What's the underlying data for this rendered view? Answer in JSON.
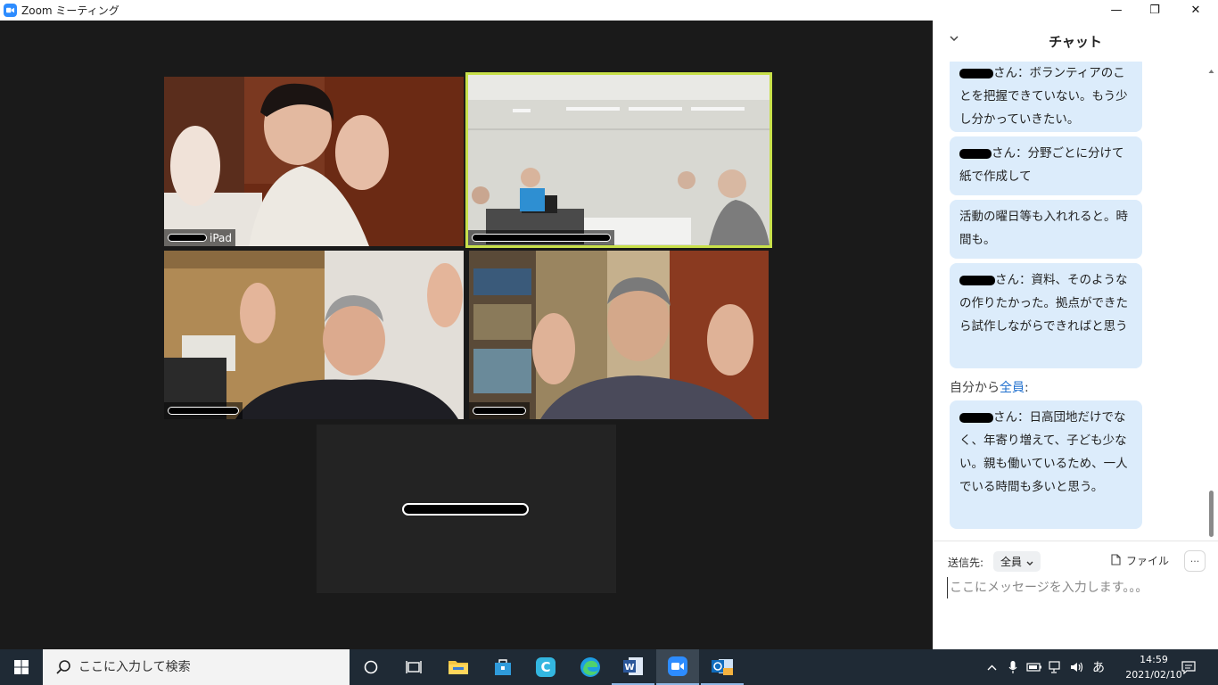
{
  "window": {
    "title": "Zoom ミーティング",
    "minimize_glyph": "—",
    "restore_glyph": "❐",
    "close_glyph": "✕"
  },
  "video": {
    "tiles": [
      {
        "name_suffix": "iPad"
      },
      {
        "name_suffix": ""
      },
      {
        "name_suffix": ""
      },
      {
        "name_suffix": ""
      },
      {
        "name_suffix": ""
      }
    ],
    "active_speaker_color": "#c8e04a"
  },
  "chat": {
    "title": "チャット",
    "messages": [
      {
        "text": "さん：ボランティアのことを把握できていない。もう少し分かっていきたい。"
      },
      {
        "text": "さん：分野ごとに分けて紙で作成して"
      },
      {
        "text": "活動の曜日等も入れれると。時間も。"
      },
      {
        "text": "さん：資料、そのようなの作りたかった。拠点ができたら試作しながらできればと思う"
      },
      {
        "text": "さん：日高団地だけでなく、年寄り増えて、子ども少ない。親も働いているため、一人でいる時間も多いと思う。"
      }
    ],
    "sender_from": "自分から",
    "sender_to": "全員",
    "sender_suffix": ":",
    "compose": {
      "recipient_label": "送信先:",
      "recipient_value": "全員",
      "file_label": "ファイル",
      "more_label": "···",
      "placeholder": "ここにメッセージを入力します。。。"
    }
  },
  "taskbar": {
    "search_placeholder": "ここに入力して検索",
    "ime_indicator": "あ",
    "time": "14:59",
    "date": "2021/02/10"
  },
  "colors": {
    "zoom_blue": "#2d8cff",
    "chat_bubble": "#dcecfb",
    "link_blue": "#1f6fce",
    "taskbar": "#1f2a35"
  }
}
